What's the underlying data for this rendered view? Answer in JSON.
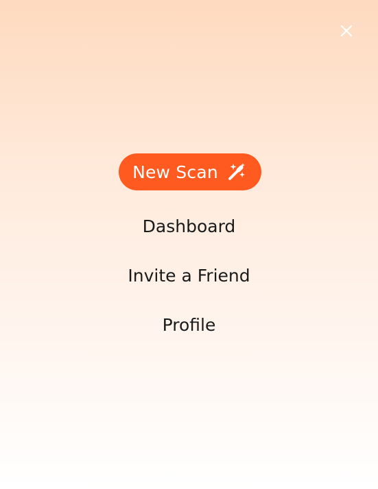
{
  "theme": {
    "accent": "#ff5a1f",
    "background_top": "#fedabf",
    "background_bottom": "#ffffff",
    "text": "#1a1a1a"
  },
  "header": {
    "close_icon": "close-icon"
  },
  "menu": {
    "new_scan": {
      "label": "New Scan",
      "icon": "magic-wand-sparkles-icon"
    },
    "items": [
      {
        "label": "Dashboard"
      },
      {
        "label": "Invite a Friend"
      },
      {
        "label": "Profile"
      }
    ]
  }
}
